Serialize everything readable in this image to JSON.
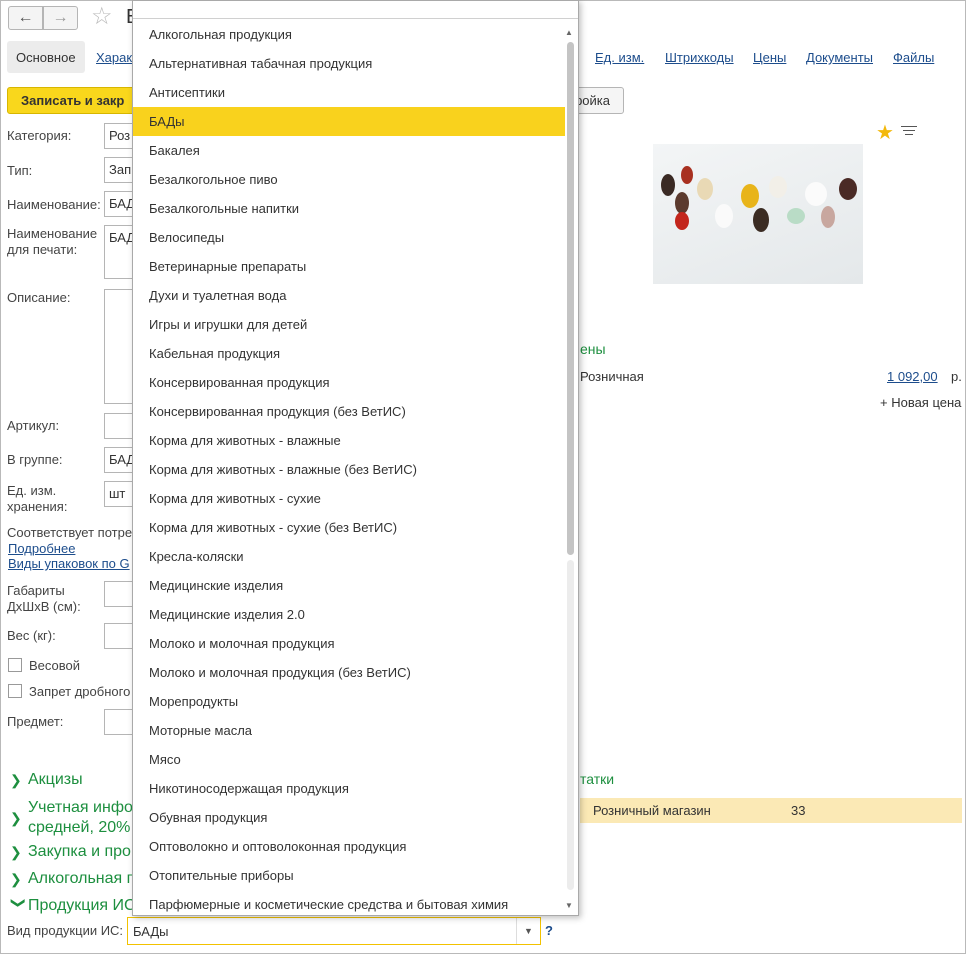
{
  "header": {
    "back_icon": "arrow-left-icon",
    "forward_icon": "arrow-right-icon",
    "title_fragment": "Б"
  },
  "tabs": {
    "main": "Основное",
    "characteristics": "Харак",
    "units": "Ед. изм.",
    "barcodes": "Штрихкоды",
    "prices": "Цены",
    "documents": "Документы",
    "files": "Файлы"
  },
  "toolbar": {
    "save_close": "Записать и закр",
    "setup": "ройка"
  },
  "form": {
    "category_label": "Категория:",
    "category_value": "Роз",
    "type_label": "Тип:",
    "type_value": "Зап",
    "name_label": "Наименование:",
    "name_value": "БАД",
    "print_name_label": "Наименование для печати:",
    "print_name_value": "БАД",
    "description_label": "Описание:",
    "article_label": "Артикул:",
    "group_label": "В группе:",
    "group_value": "БАД",
    "storage_unit_label": "Ед. изм. хранения:",
    "storage_unit_value": "шт",
    "matches_text": "Соответствует потре",
    "more_link": "Подробнее",
    "packaging_link": "Виды упаковок по G",
    "dimensions_label": "Габариты ДхШхВ (см):",
    "weight_label": "Вес (кг):",
    "weighted_label": "Весовой",
    "fractional_ban_label": "Запрет дробного",
    "subject_label": "Предмет:"
  },
  "sections": {
    "excise": "Акцизы",
    "accounting_1": "Учетная инфо",
    "accounting_2": "средней, 20%",
    "purchase": "Закупка и про",
    "alcohol": "Алкогольная п",
    "is_products": "Продукция ИС",
    "prices_fragment": "ены",
    "stock_fragment": "татки"
  },
  "prices": {
    "retail_label": "Розничная",
    "retail_value": "1 092,00",
    "currency": "р.",
    "new_price": "+ Новая цена"
  },
  "stock": {
    "store": "Розничный магазин",
    "qty": "33"
  },
  "is_field": {
    "label": "Вид продукции ИС:",
    "value": "БАДы",
    "help": "?"
  },
  "dropdown": {
    "selected_index": 3,
    "items": [
      "Алкогольная продукция",
      "Альтернативная табачная продукция",
      "Антисептики",
      "БАДы",
      "Бакалея",
      "Безалкогольное пиво",
      "Безалкогольные напитки",
      "Велосипеды",
      "Ветеринарные препараты",
      "Духи и туалетная вода",
      "Игры и игрушки для детей",
      "Кабельная продукция",
      "Консервированная продукция",
      "Консервированная продукция (без ВетИС)",
      "Корма для животных - влажные",
      "Корма для животных - влажные (без ВетИС)",
      "Корма для животных - сухие",
      "Корма для животных - сухие (без ВетИС)",
      "Кресла-коляски",
      "Медицинские изделия",
      "Медицинские изделия 2.0",
      "Молоко и молочная продукция",
      "Молоко и молочная продукция (без ВетИС)",
      "Морепродукты",
      "Моторные масла",
      "Мясо",
      "Никотиносодержащая продукция",
      "Обувная продукция",
      "Оптоволокно и оптоволоконная продукция",
      "Отопительные приборы",
      "Парфюмерные и косметические средства и бытовая химия"
    ]
  },
  "colors": {
    "accent_yellow": "#f9d21d",
    "section_green": "#1d8f3f",
    "link_blue": "#1d4d8c",
    "row_highlight": "#fbe9b5"
  }
}
